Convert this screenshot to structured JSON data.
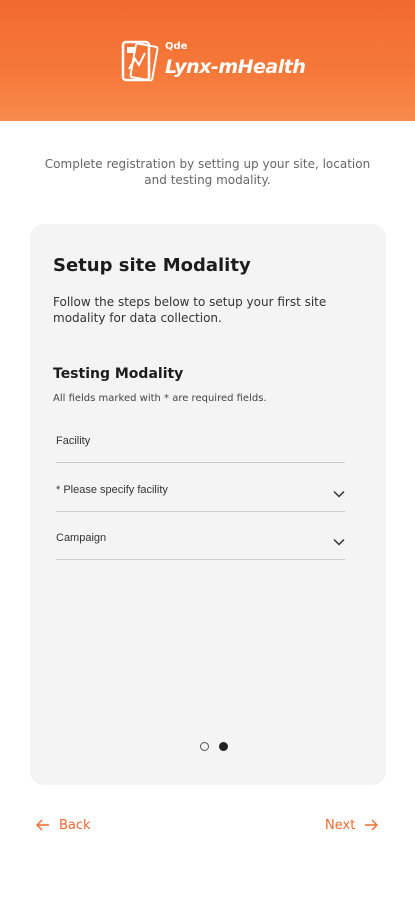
{
  "header": {
    "logo_small": "Qde",
    "logo_name": "Lynx-mHealth"
  },
  "subtitle": "Complete registration by setting up your site, location and testing modality.",
  "card": {
    "title": "Setup site Modality",
    "description": "Follow the steps below to setup your first site modality for data collection.",
    "section_title": "Testing Modality",
    "section_note": "All fields marked with * are required fields.",
    "fields": [
      {
        "label": "Facility",
        "has_dropdown": false
      },
      {
        "label": "* Please specify facility",
        "has_dropdown": true
      },
      {
        "label": "Campaign",
        "has_dropdown": true
      }
    ],
    "pager": {
      "current": 2,
      "total": 2
    }
  },
  "nav": {
    "back_label": "Back",
    "next_label": "Next"
  },
  "colors": {
    "accent": "#f26a2e",
    "card_bg": "#f4f4f4"
  }
}
